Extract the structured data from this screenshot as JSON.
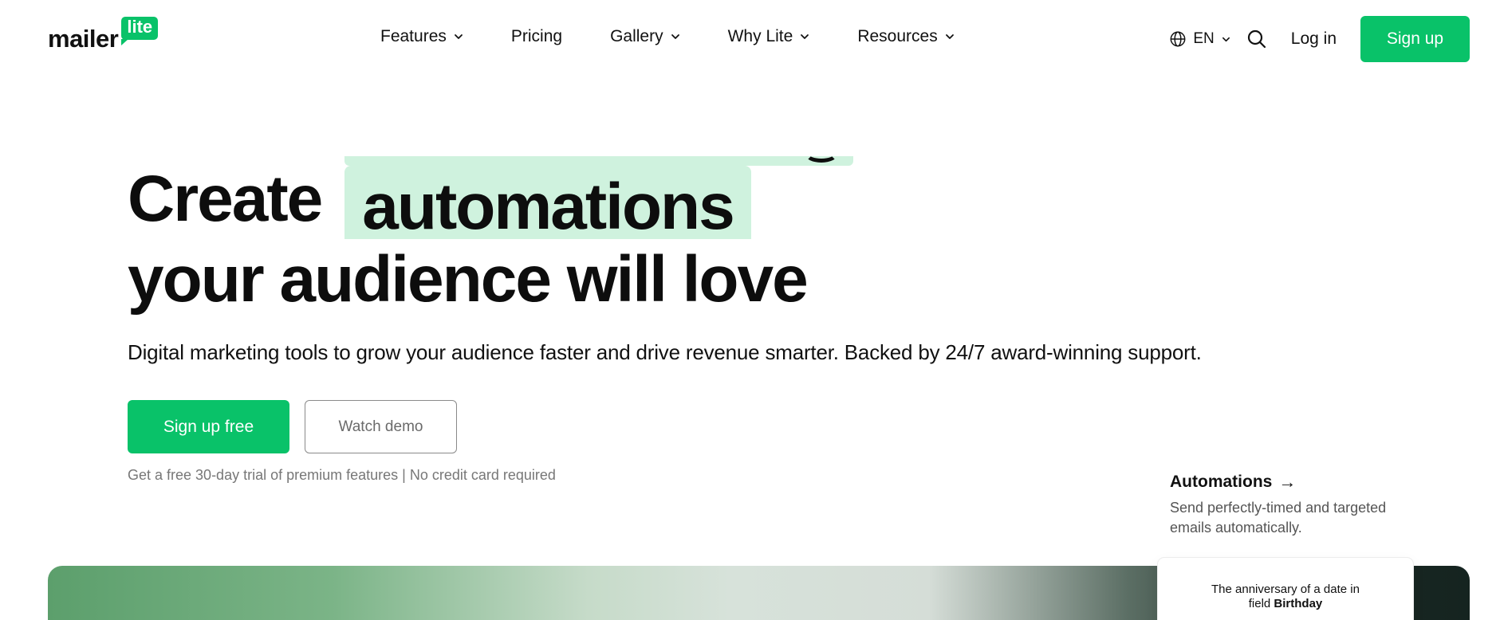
{
  "logo": {
    "word": "mailer",
    "badge": "lite"
  },
  "nav": {
    "items": [
      {
        "label": "Features",
        "has_dropdown": true
      },
      {
        "label": "Pricing",
        "has_dropdown": false
      },
      {
        "label": "Gallery",
        "has_dropdown": true
      },
      {
        "label": "Why Lite",
        "has_dropdown": true
      },
      {
        "label": "Resources",
        "has_dropdown": true
      }
    ]
  },
  "header_right": {
    "language": "EN",
    "search_icon": "search-icon",
    "login_label": "Log in",
    "signup_label": "Sign up"
  },
  "hero": {
    "headline_word_1": "Create",
    "headline_rotating_word": "automations",
    "headline_line_2": "your audience will love",
    "subtitle": "Digital marketing tools to grow your audience faster and drive revenue smarter. Backed by 24/7 award-winning support.",
    "primary_cta": "Sign up free",
    "secondary_cta": "Watch demo",
    "trial_note": "Get a free 30-day trial of premium features | No credit card required"
  },
  "feature": {
    "title": "Automations",
    "arrow": "→",
    "description": "Send perfectly-timed and targeted emails automatically."
  },
  "trigger_card": {
    "line1": "The anniversary of a date in",
    "line2_prefix": "field ",
    "line2_bold": "Birthday"
  },
  "colors": {
    "brand_green": "#09c269",
    "highlight_green": "#cff2de",
    "text_dark": "#0d0d0d",
    "muted_text": "#777777"
  }
}
